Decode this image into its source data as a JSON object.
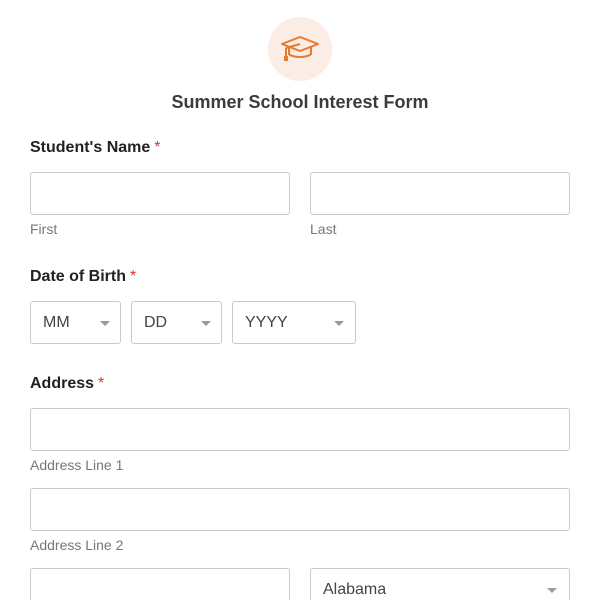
{
  "logo": {
    "icon": "graduation-cap-icon",
    "color": "#e8792e",
    "background": "#fbece4"
  },
  "form": {
    "title": "Summer School Interest Form"
  },
  "required_marker": "*",
  "student_name": {
    "label": "Student's Name",
    "first": {
      "value": "",
      "sublabel": "First"
    },
    "last": {
      "value": "",
      "sublabel": "Last"
    }
  },
  "dob": {
    "label": "Date of Birth",
    "month": "MM",
    "day": "DD",
    "year": "YYYY"
  },
  "address": {
    "label": "Address",
    "line1": {
      "value": "",
      "sublabel": "Address Line 1"
    },
    "line2": {
      "value": "",
      "sublabel": "Address Line 2"
    },
    "city": {
      "value": ""
    },
    "state": {
      "selected": "Alabama"
    }
  }
}
